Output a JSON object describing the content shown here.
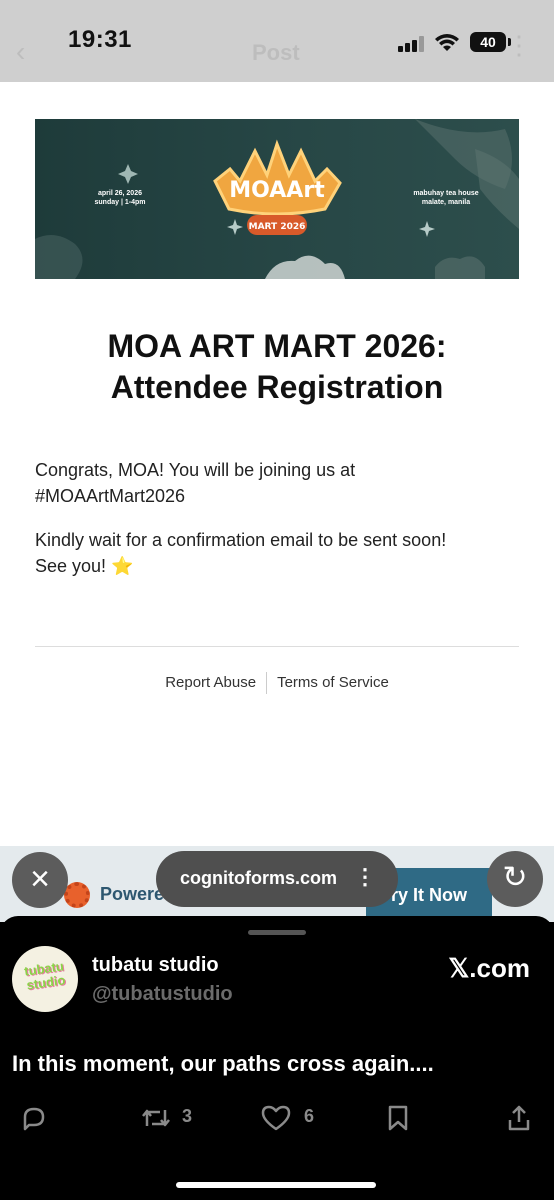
{
  "status_bar": {
    "time": "19:31",
    "battery": "40"
  },
  "header": {
    "title": "Post",
    "back_icon": "chevron-left-icon",
    "more_icon": "more-icon"
  },
  "banner": {
    "logo_text": "MOAArt",
    "logo_subtext": "MART 2026",
    "date_line1": "april 26, 2026",
    "date_line2": "sunday | 1-4pm",
    "venue_line1": "mabuhay tea house",
    "venue_line2": "malate, manila"
  },
  "form": {
    "title_line1": "MOA ART MART 2026:",
    "title_line2": "Attendee Registration",
    "para1_line1": "Congrats, MOA! You will be joining us at",
    "para1_line2": "#MOAArtMart2026",
    "para2_line1": "Kindly wait for a confirmation email to be sent soon!",
    "para2_line2": "See you!",
    "star_glyph": "⭐",
    "footer_links": [
      "Report Abuse",
      "Terms of Service"
    ]
  },
  "cognito_bar": {
    "powered_label": "Powere",
    "try_label": "ry It Now"
  },
  "browser": {
    "url": "cognitoforms.com",
    "close_icon": "close-icon",
    "reload_icon": "reload-icon"
  },
  "sheet": {
    "avatar_text_line1": "tubatu",
    "avatar_text_line2": "studio",
    "display_name": "tubatu studio",
    "handle": "@tubatustudio",
    "site": "𝕏.com",
    "tweet_text": "In this moment, our paths cross again....",
    "retweet_count": "3",
    "like_count": "6"
  },
  "colors": {
    "banner_bg": "#274746",
    "accent": "#2f6a85",
    "logo_orange": "#f0a640"
  }
}
